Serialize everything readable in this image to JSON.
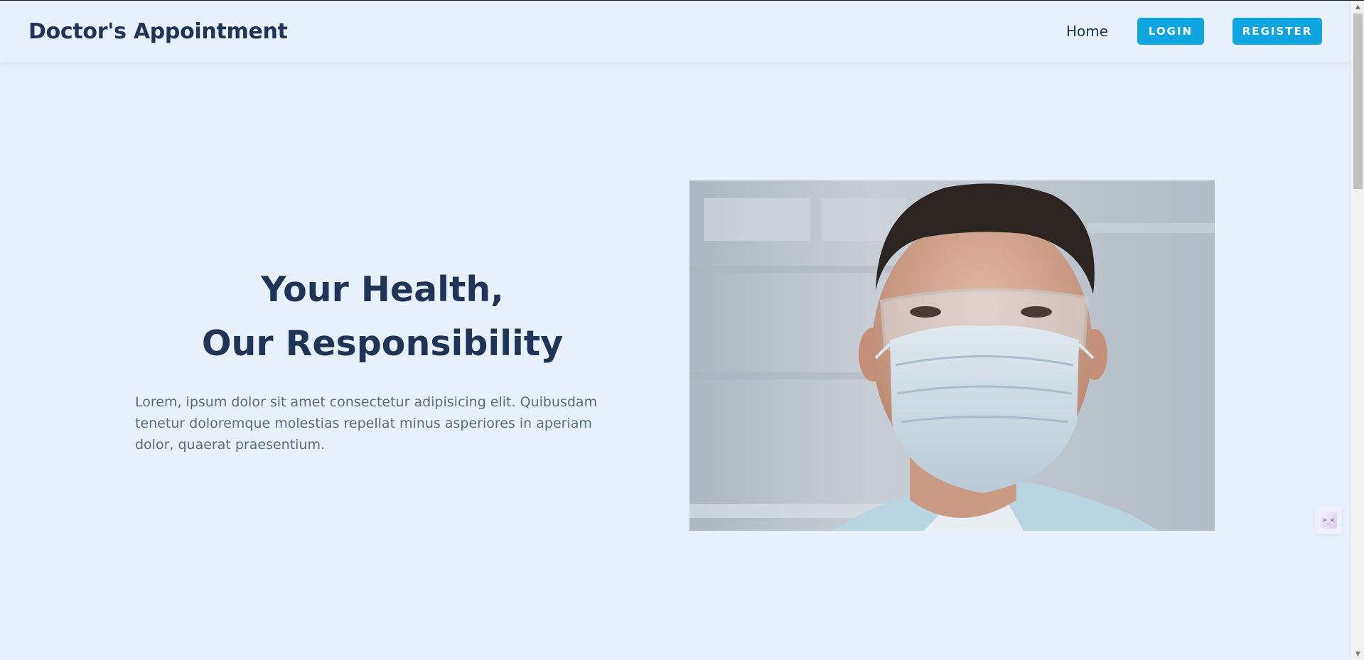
{
  "header": {
    "brand": "Doctor's Appointment",
    "nav_home": "Home",
    "login_label": "LOGIN",
    "register_label": "REGISTER"
  },
  "hero": {
    "title_line1": "Your Health,",
    "title_line2": "Our Responsibility",
    "description": "Lorem, ipsum dolor sit amet consectetur adipisicing elit. Quibusdam tenetur doloremque molestias repellat minus asperiores in aperiam dolor, quaerat praesentium.",
    "image_subject": "doctor wearing surgical mask and safety glasses"
  },
  "widget": {
    "glyph": ">_<"
  },
  "colors": {
    "background": "#e8f1fb",
    "brand_text": "#1e3557",
    "button_accent": "#0ea5e0",
    "body_text": "#5a6b80"
  }
}
